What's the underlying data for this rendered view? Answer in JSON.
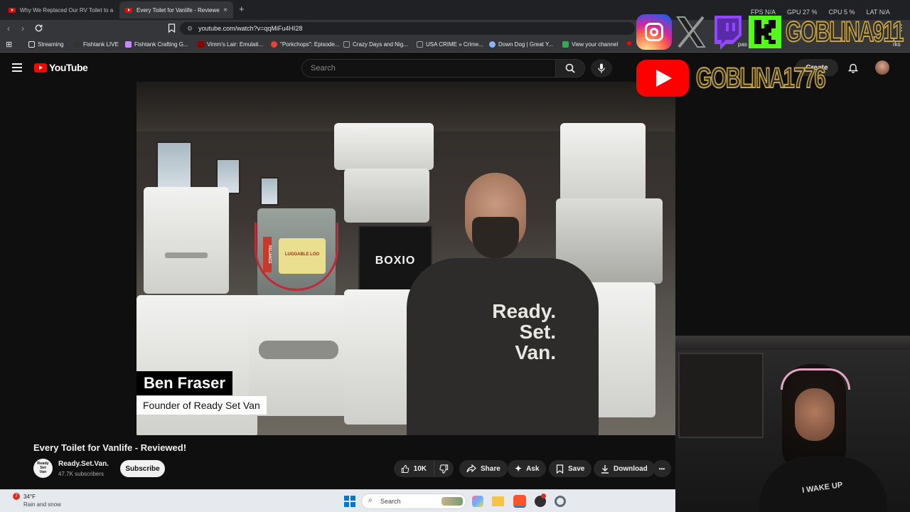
{
  "browser": {
    "tabs": [
      {
        "label": "Why We Replaced Our RV Toilet to a"
      },
      {
        "label": "Every Toilet for Vanlife - Reviewe"
      }
    ],
    "new_tab": "+",
    "tab_close": "×",
    "url": "youtube.com/watch?v=qqMiFu4HI28"
  },
  "bookmarks": [
    {
      "label": "Streaming",
      "color": "#9aa0a6"
    },
    {
      "label": "Fishtank LIVE",
      "color": "#cccccc"
    },
    {
      "label": "Fishtank Crafting G...",
      "color": "#c58af9"
    },
    {
      "label": "Vimm's Lair: Emulati...",
      "color": "#8b0000"
    },
    {
      "label": "\"Porkchops\": Episode...",
      "color": "#ea4335"
    },
    {
      "label": "Crazy Days and Nig...",
      "color": "#9aa0a6"
    },
    {
      "label": "USA CRIME » Crime...",
      "color": "#4285f4"
    },
    {
      "label": "Down Dog | Great Y...",
      "color": "#8ab4f8"
    },
    {
      "label": "View your channel",
      "color": "#34a853"
    },
    {
      "label": "pas",
      "color": "#ff0000"
    },
    {
      "label": "rks",
      "color": "#9aa0a6"
    }
  ],
  "youtube": {
    "logo_text": "YouTube",
    "search_placeholder": "Search",
    "create_label": "Create"
  },
  "video": {
    "lower_third_name": "Ben Fraser",
    "lower_third_title": "Founder of Ready Set Van",
    "scene_box_brand": "BOXIO",
    "bucket_label": "LUGGABLE LOO",
    "bucket_brand": "RELIANCE",
    "shirt_text": [
      "Ready.",
      "Set.",
      "Van."
    ]
  },
  "below_video": {
    "title": "Every Toilet for Vanlife - Reviewed!",
    "channel_name": "Ready.Set.Van.",
    "channel_avatar_text": [
      "Ready",
      "Set",
      "Van"
    ],
    "subscribers": "47.7K subscribers",
    "subscribe_label": "Subscribe",
    "like_count": "10K",
    "share_label": "Share",
    "ask_label": "Ask",
    "save_label": "Save",
    "download_label": "Download",
    "more_label": "•••"
  },
  "overlay": {
    "handle_1": "GOBLINA911",
    "handle_2": "GOBLINA1776",
    "stats": [
      "FPS N/A",
      "GPU 27 %",
      "CPU 5 %",
      "LAT N/A"
    ],
    "webcam_shirt_text": "I WAKE UP"
  },
  "taskbar": {
    "weather_temp": "34°F",
    "weather_desc": "Rain and snow",
    "weather_badge": "7",
    "search_placeholder": "Search"
  },
  "colors": {
    "youtube_red": "#ff0000",
    "handle_outline": "#c9a642",
    "kick_green": "#53fc18",
    "twitch_purple": "#9146ff"
  }
}
